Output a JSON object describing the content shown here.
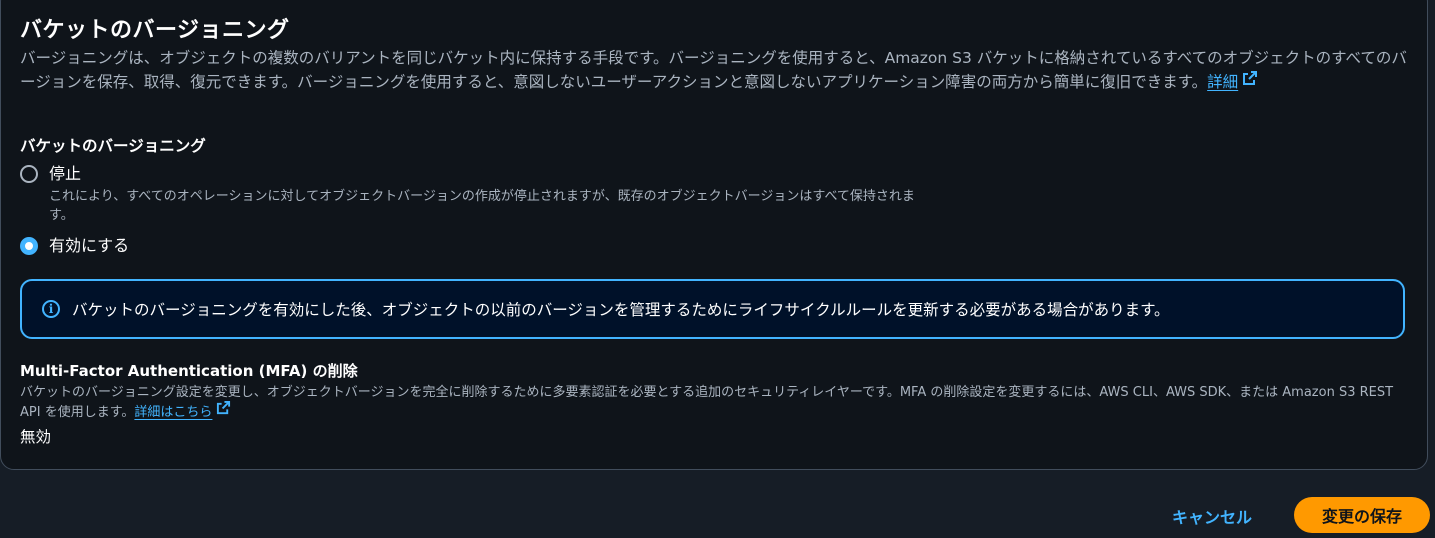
{
  "section": {
    "title": "バケットのバージョニング",
    "description": "バージョニングは、オブジェクトの複数のバリアントを同じバケット内に保持する手段です。バージョニングを使用すると、Amazon S3 バケットに格納されているすべてのオブジェクトのすべてのバージョンを保存、取得、復元できます。バージョニングを使用すると、意図しないユーザーアクションと意図しないアプリケーション障害の両方から簡単に復旧できます。",
    "learn_more_label": "詳細"
  },
  "versioning_field": {
    "label": "バケットのバージョニング",
    "options": [
      {
        "label": "停止",
        "description": "これにより、すべてのオペレーションに対してオブジェクトバージョンの作成が停止されますが、既存のオブジェクトバージョンはすべて保持されます。",
        "selected": false
      },
      {
        "label": "有効にする",
        "description": "",
        "selected": true
      }
    ]
  },
  "alert": {
    "icon": "info-icon",
    "text": "バケットのバージョニングを有効にした後、オブジェクトの以前のバージョンを管理するためにライフサイクルルールを更新する必要がある場合があります。"
  },
  "mfa": {
    "title": "Multi-Factor Authentication (MFA) の削除",
    "description": "バケットのバージョニング設定を変更し、オブジェクトバージョンを完全に削除するために多要素認証を必要とする追加のセキュリティレイヤーです。MFA の削除設定を変更するには、AWS CLI、AWS SDK、または Amazon S3 REST API を使用します。",
    "learn_more_label": "詳細はこちら",
    "value": "無効"
  },
  "footer": {
    "cancel_label": "キャンセル",
    "save_label": "変更の保存"
  },
  "colors": {
    "accent": "#42b4ff",
    "primary_button": "#ff9900",
    "background": "#0f141a",
    "alert_background": "#001129"
  }
}
